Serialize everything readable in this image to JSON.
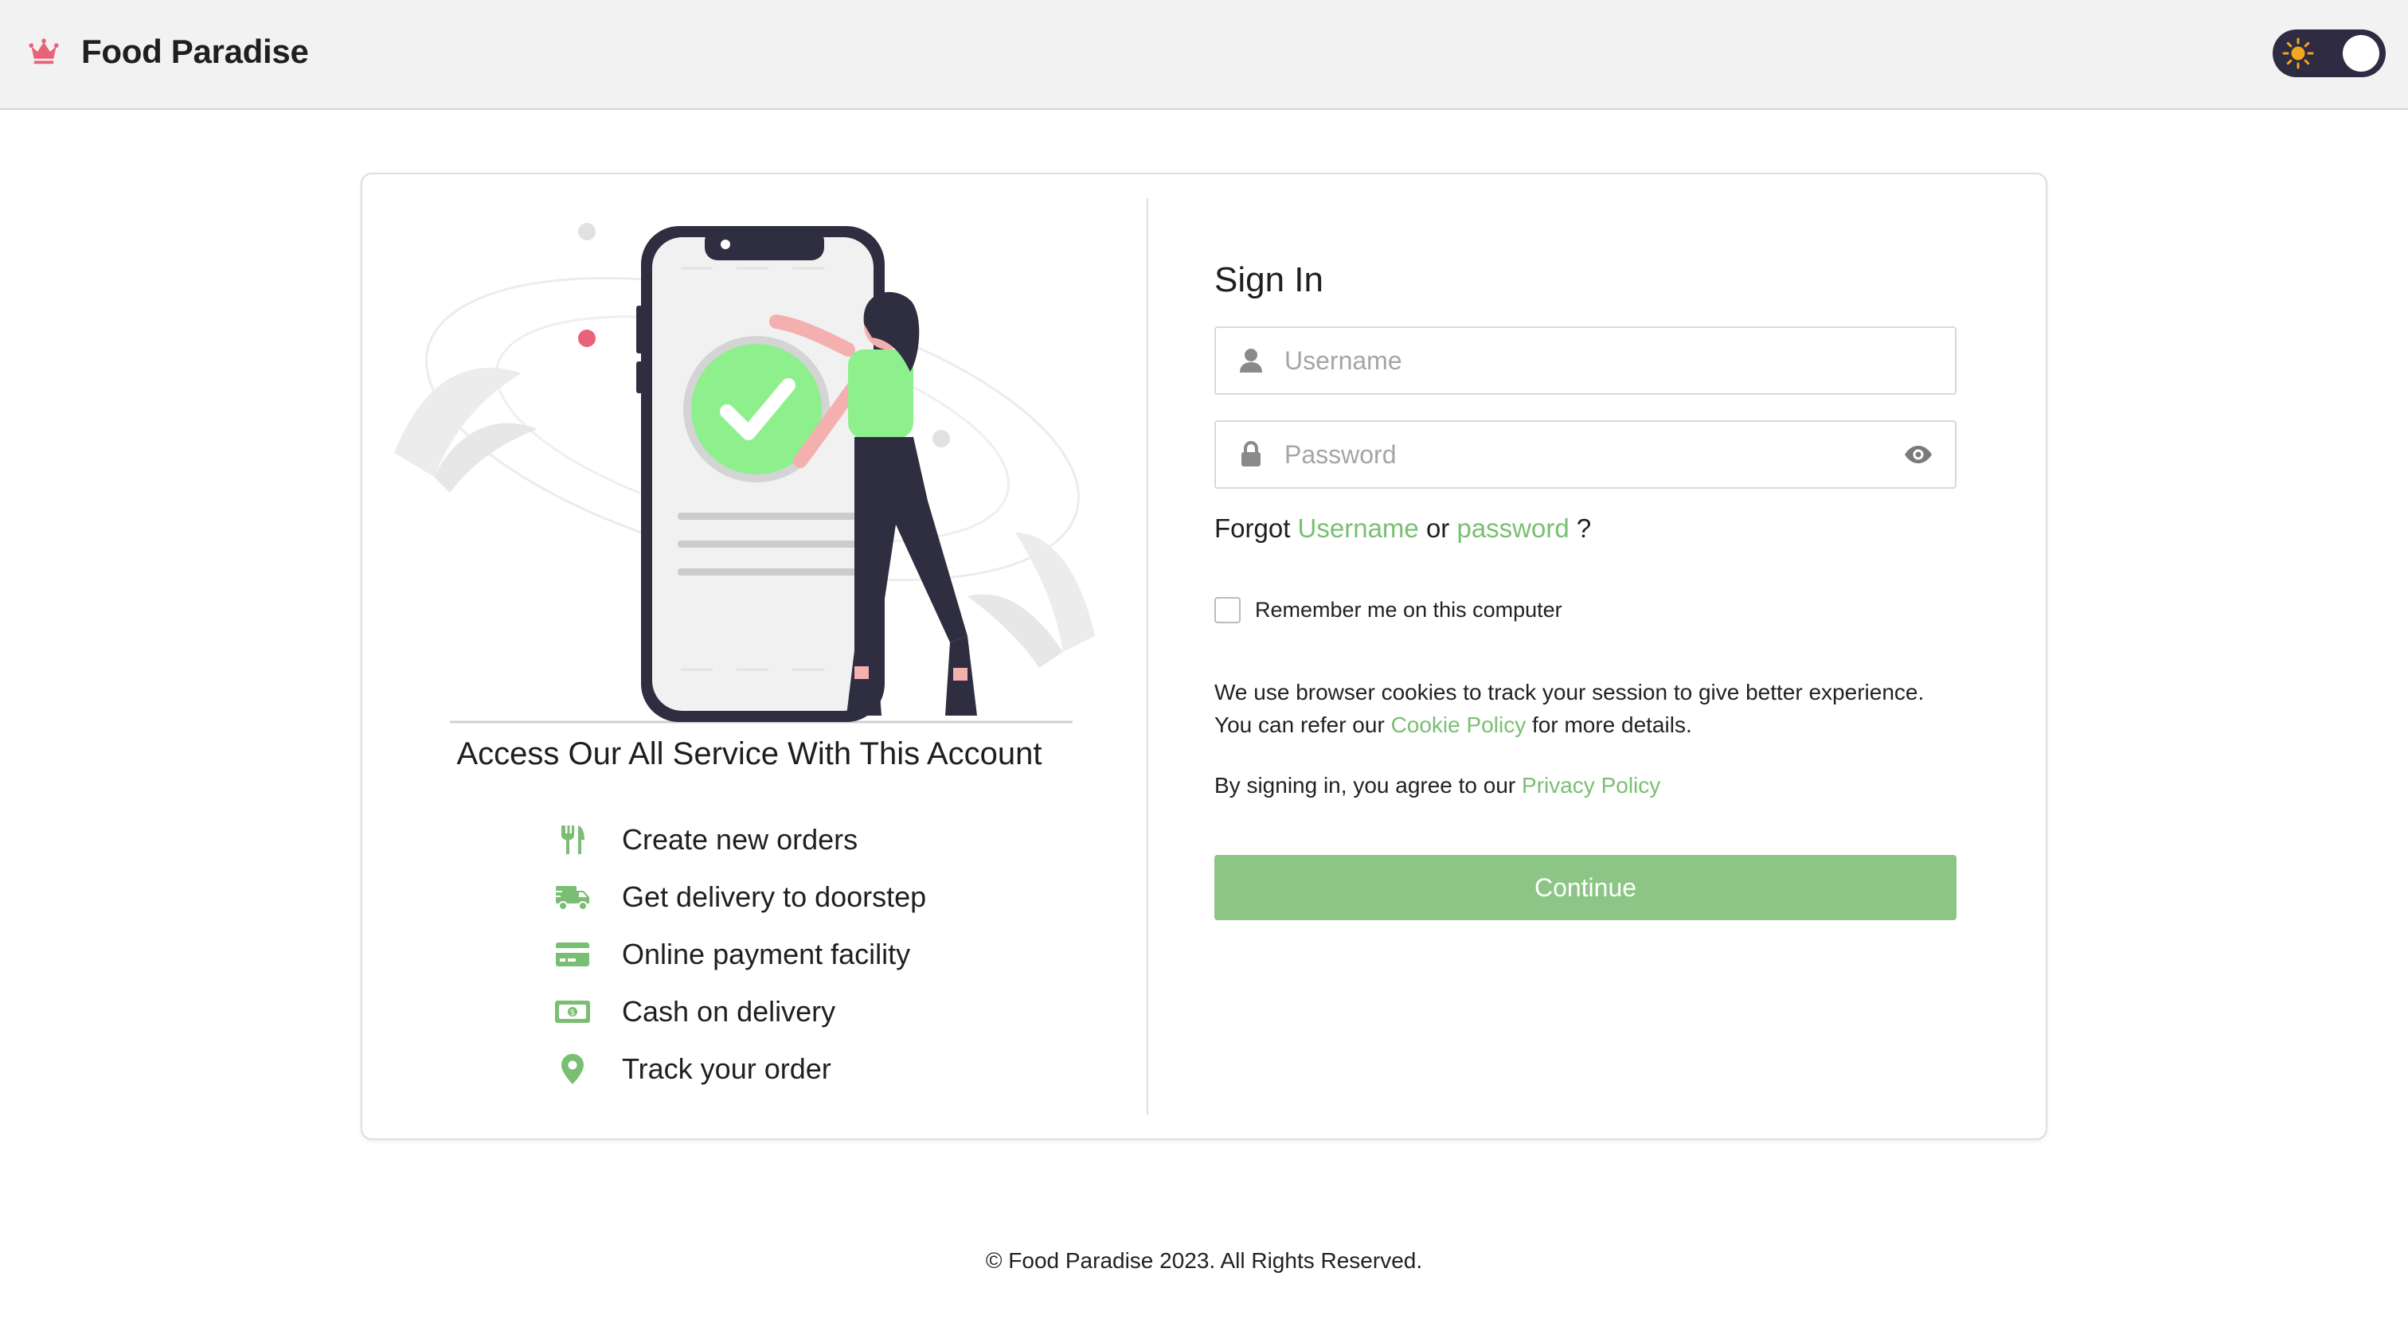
{
  "header": {
    "brand_name": "Food Paradise",
    "brand_icon": "crown-icon",
    "theme_toggle_icon": "sun-icon"
  },
  "left_panel": {
    "title": "Access Our All Service With This Account",
    "features": [
      {
        "icon": "utensils-icon",
        "label": "Create new orders"
      },
      {
        "icon": "delivery-truck-icon",
        "label": "Get delivery to doorstep"
      },
      {
        "icon": "credit-card-icon",
        "label": "Online payment facility"
      },
      {
        "icon": "cash-icon",
        "label": "Cash on delivery"
      },
      {
        "icon": "location-pin-icon",
        "label": "Track your order"
      }
    ]
  },
  "signin": {
    "title": "Sign In",
    "username_placeholder": "Username",
    "password_placeholder": "Password",
    "forgot_prefix": "Forgot",
    "forgot_username": "Username",
    "forgot_or": "or",
    "forgot_password": "password",
    "forgot_suffix": "?",
    "remember_label": "Remember me on this computer",
    "cookie_line1": "We use browser cookies to track your session to give better experience.",
    "cookie_line2_prefix": "You can refer our",
    "cookie_link": "Cookie Policy",
    "cookie_line2_suffix": "for more details.",
    "agree_prefix": "By signing in, you agree to our",
    "privacy_link": "Privacy Policy",
    "continue_label": "Continue"
  },
  "footer": {
    "text": "© Food Paradise 2023. All Rights Reserved."
  },
  "colors": {
    "accent": "#79bf73",
    "button": "#8cc585",
    "brand_icon": "#e8637a",
    "header_bg": "#f2f2f2",
    "toggle_bg": "#2e2b43"
  }
}
